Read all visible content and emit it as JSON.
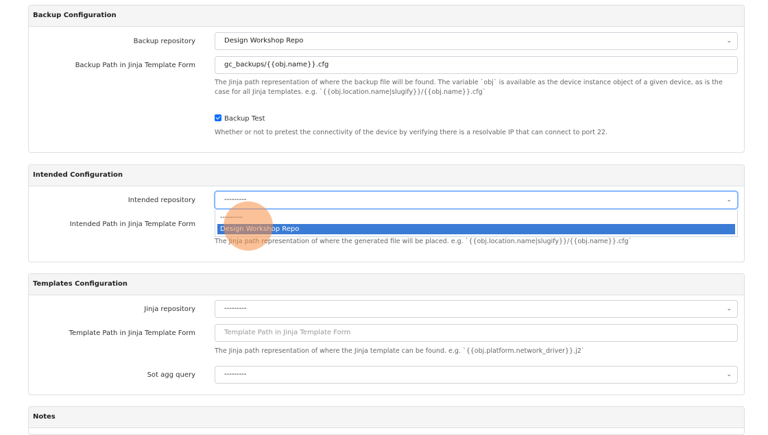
{
  "backup": {
    "title": "Backup Configuration",
    "repo_label": "Backup repository",
    "repo_value": "Design Workshop Repo",
    "path_label": "Backup Path in Jinja Template Form",
    "path_value": "gc_backups/{{obj.name}}.cfg",
    "path_help": "The Jinja path representation of where the backup file will be found. The variable `obj` is available as the device instance object of a given device, as is the case for all Jinja templates. e.g. `{{obj.location.name|slugify}}/{{obj.name}}.cfg`",
    "test_label": "Backup Test",
    "test_checked": true,
    "test_help": "Whether or not to pretest the connectivity of the device by verifying there is a resolvable IP that can connect to port 22."
  },
  "intended": {
    "title": "Intended Configuration",
    "repo_label": "Intended repository",
    "repo_value": "---------",
    "options": [
      "---------",
      "Design Workshop Repo"
    ],
    "highlighted_option": "Design Workshop Repo",
    "path_label": "Intended Path in Jinja Template Form",
    "path_help": "The Jinja path representation of where the generated file will be placed. e.g. `{{obj.location.name|slugify}}/{{obj.name}}.cfg`"
  },
  "templates": {
    "title": "Templates Configuration",
    "repo_label": "Jinja repository",
    "repo_value": "---------",
    "path_label": "Template Path in Jinja Template Form",
    "path_placeholder": "Template Path in Jinja Template Form",
    "path_help": "The Jinja path representation of where the Jinja template can be found. e.g. `{{obj.platform.network_driver}}.j2`",
    "sot_label": "Sot agg query",
    "sot_value": "---------"
  },
  "notes": {
    "title": "Notes"
  },
  "colors": {
    "accent": "#0d6efd",
    "highlight": "#3a7bd5",
    "cursor": "#f78f46"
  }
}
